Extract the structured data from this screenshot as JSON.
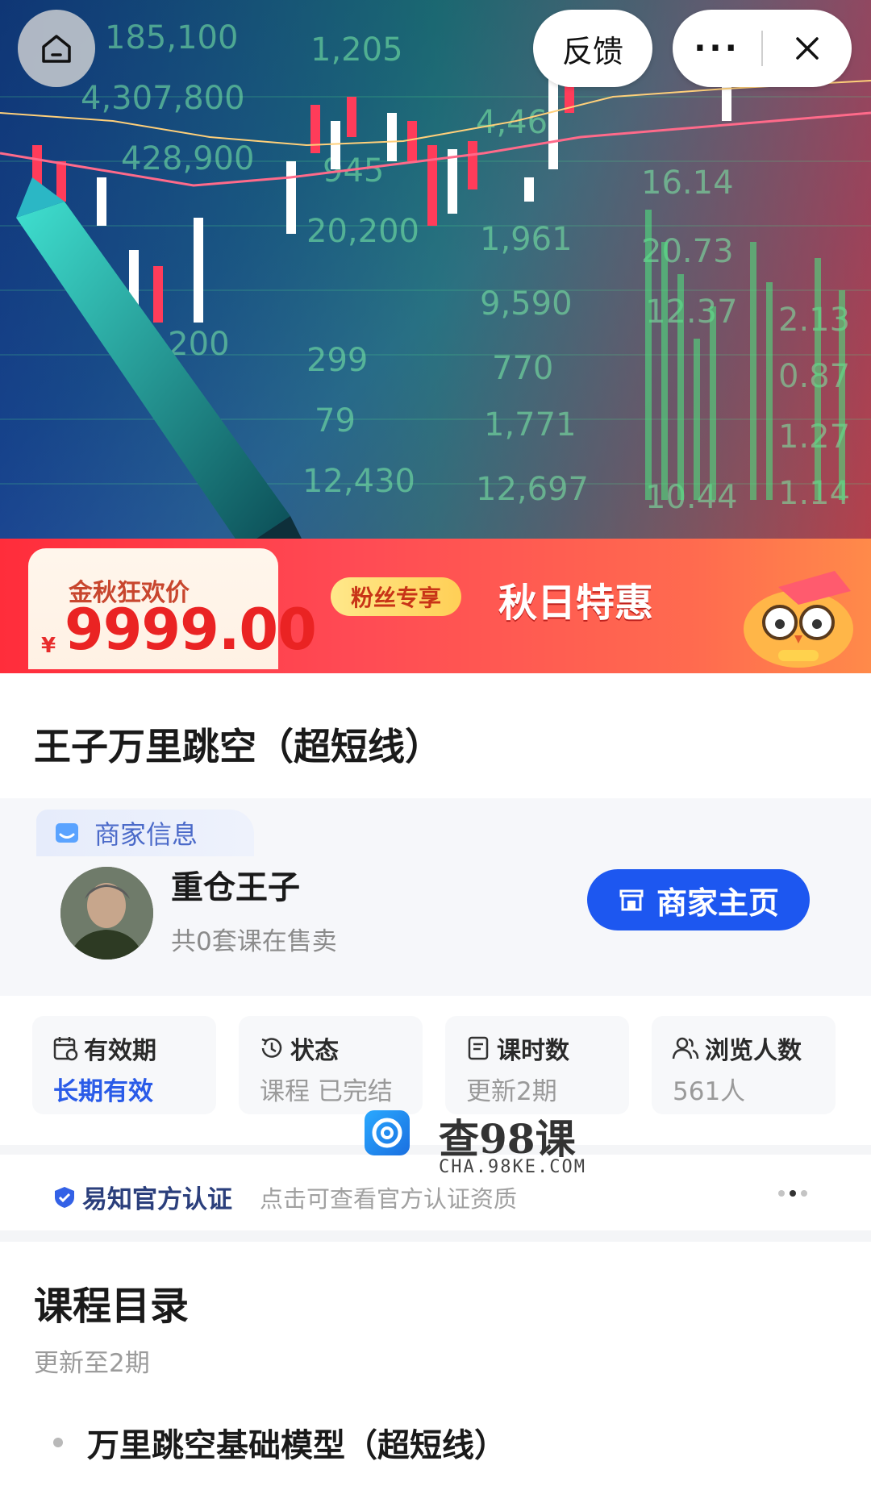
{
  "header": {
    "feedback_label": "反馈",
    "more_label": "···"
  },
  "promo": {
    "price_label": "金秋狂欢价",
    "currency": "¥",
    "price": "9999.00",
    "fan_tag": "粉丝专享",
    "campaign": "秋日特惠"
  },
  "course": {
    "title": "王子万里跳空（超短线）"
  },
  "merchant": {
    "section_label": "商家信息",
    "name": "重仓王子",
    "subtitle": "共0套课在售卖",
    "home_button": "商家主页"
  },
  "stats": [
    {
      "label": "有效期",
      "value": "长期有效",
      "icon": "calendar-icon"
    },
    {
      "label": "状态",
      "value": "课程 已完结",
      "icon": "history-clock-icon"
    },
    {
      "label": "课时数",
      "value": "更新2期",
      "icon": "document-icon"
    },
    {
      "label": "浏览人数",
      "value": "561人",
      "icon": "users-icon"
    }
  ],
  "watermark": {
    "title": "查98课",
    "url": "CHA.98KE.COM"
  },
  "certification": {
    "badge": "易知官方认证",
    "description": "点击可查看官方认证资质"
  },
  "catalog": {
    "title": "课程目录",
    "subtitle": "更新至2期",
    "lessons": [
      "万里跳空基础模型（超短线）"
    ]
  },
  "colors": {
    "primary_blue": "#1d57f0",
    "price_red": "#ea2323",
    "promo_red": "#ff2d3b"
  }
}
